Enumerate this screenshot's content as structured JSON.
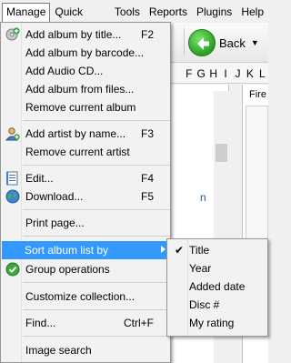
{
  "menubar": {
    "items": [
      {
        "label": "Manage",
        "active": true
      },
      {
        "label": "Quick filter"
      },
      {
        "label": "Tools"
      },
      {
        "label": "Reports"
      },
      {
        "label": "Plugins"
      },
      {
        "label": "Help"
      }
    ]
  },
  "toolbar": {
    "back_label": "Back"
  },
  "alphabet": [
    "F",
    "G",
    "H",
    "I",
    "J",
    "K",
    "L"
  ],
  "left_pane_link": "n",
  "right_pane_tab": "Fire",
  "manage_menu": {
    "items": [
      {
        "label": "Add album by title...",
        "shortcut": "F2",
        "icon": "add-album-icon"
      },
      {
        "label": "Add album by barcode..."
      },
      {
        "label": "Add Audio CD..."
      },
      {
        "label": "Add album from files..."
      },
      {
        "label": "Remove current album"
      },
      {
        "label": "Add artist by name...",
        "shortcut": "F3",
        "icon": "add-artist-icon"
      },
      {
        "label": "Remove current artist"
      },
      {
        "label": "Edit...",
        "shortcut": "F4",
        "icon": "edit-icon"
      },
      {
        "label": "Download...",
        "shortcut": "F5",
        "icon": "globe-icon"
      },
      {
        "label": "Print page..."
      },
      {
        "label": "Sort album list by"
      },
      {
        "label": "Group operations",
        "icon": "check-circle-icon"
      },
      {
        "label": "Customize collection..."
      },
      {
        "label": "Find...",
        "shortcut": "Ctrl+F"
      },
      {
        "label": "Image search"
      }
    ]
  },
  "sort_submenu": {
    "selected": "Title",
    "items": [
      {
        "label": "Title"
      },
      {
        "label": "Year"
      },
      {
        "label": "Added date"
      },
      {
        "label": "Disc #"
      },
      {
        "label": "My rating"
      }
    ]
  },
  "colors": {
    "highlight": "#3399ff",
    "menu_bg": "#f2f2f2",
    "back_green": "#2a9e25"
  }
}
